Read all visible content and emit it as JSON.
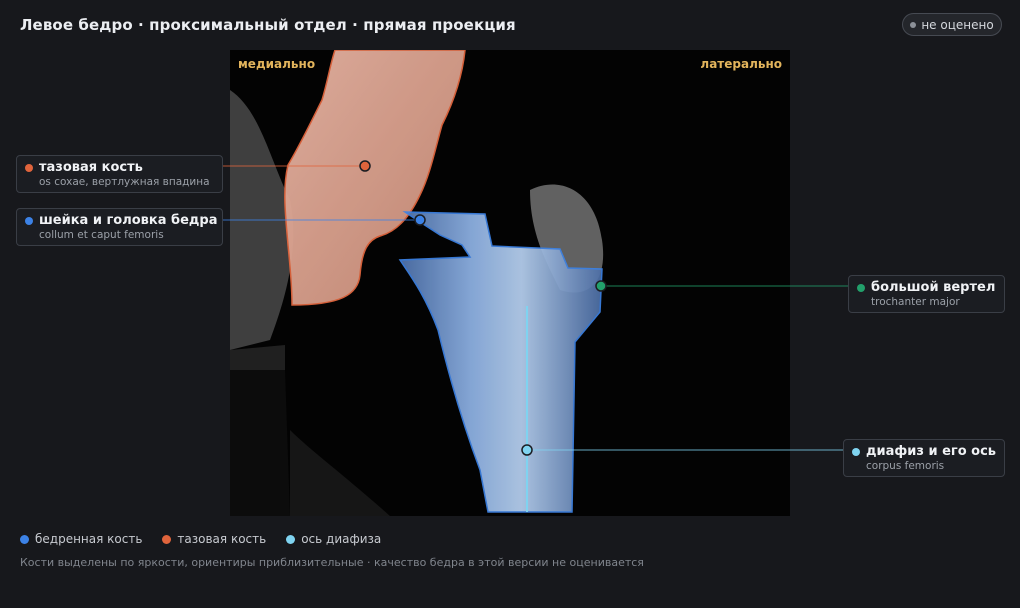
{
  "header": {
    "title": "Левое бедро · проксимальный отдел · прямая проекция",
    "status_badge": "не оценено"
  },
  "image": {
    "orientation_left": "медиально",
    "orientation_right": "латерально"
  },
  "landmarks": [
    {
      "name": "тазовая кость",
      "latin": "os coxae, вертлужная впадина",
      "color": "#e0643c"
    },
    {
      "name": "шейка и головка бедра",
      "latin": "collum et caput femoris",
      "color": "#3c82e6"
    },
    {
      "name": "большой вертел",
      "latin": "trochanter major",
      "color": "#22a06b"
    },
    {
      "name": "диафиз и его ось",
      "latin": "corpus femoris",
      "color": "#7fd3f0"
    }
  ],
  "legend": [
    {
      "label": "бедренная кость",
      "color": "#3c82e6"
    },
    {
      "label": "тазовая кость",
      "color": "#e0643c"
    },
    {
      "label": "ось диафиза",
      "color": "#7fd3f0"
    }
  ],
  "footer": {
    "note": "Кости выделены по яркости, ориентиры приблизительные · качество бедра в этой версии не оценивается"
  }
}
